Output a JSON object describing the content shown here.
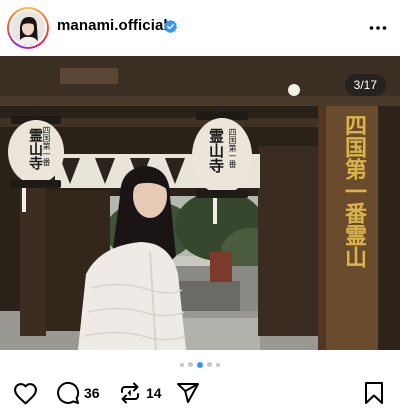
{
  "header": {
    "username": "manami.official",
    "verified": true,
    "avatar": "profile-photo",
    "more_icon": "more-horizontal-icon"
  },
  "post": {
    "image_counter": "3/17",
    "image_description_icon": "temple-gate-photo",
    "lantern_left_text": "霊山寺",
    "lantern_left_side_text": "四国第一番",
    "lantern_right_text": "霊山寺",
    "lantern_right_side_text": "四国第一番",
    "signboard_text": "四国第一番霊山",
    "carousel": {
      "total_dots": 5,
      "active_index": 2
    }
  },
  "actions": {
    "like_icon": "heart-icon",
    "comment_icon": "comment-icon",
    "comment_count": "36",
    "repost_icon": "repost-icon",
    "repost_count": "14",
    "share_icon": "send-icon",
    "save_icon": "bookmark-icon"
  },
  "colors": {
    "verified_blue": "#3897f0",
    "active_dot": "#3897f0",
    "inactive_dot": "#c7c7c7",
    "signboard_text": "#d9b44a"
  }
}
